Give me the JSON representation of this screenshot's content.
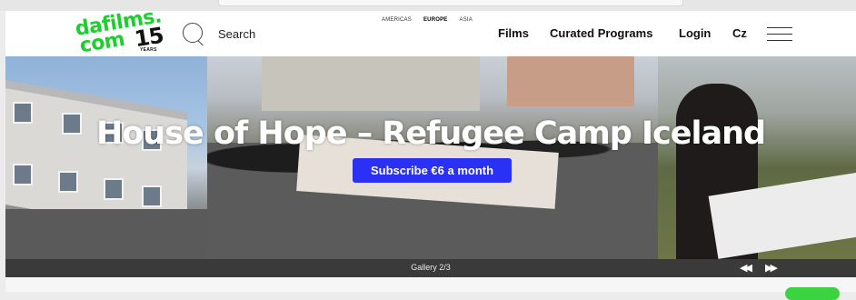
{
  "brand": {
    "logo_line1": "dafilms.",
    "logo_line2": "com",
    "anniversary_number": "15",
    "anniversary_word": "YEARS",
    "accent_color": "#1dcf2d"
  },
  "header": {
    "search_label": "Search",
    "regions": [
      "AMERICAS",
      "EUROPE",
      "ASIA"
    ],
    "active_region": "EUROPE",
    "nav": {
      "films": "Films",
      "curated_programs": "Curated Programs",
      "login": "Login",
      "language": "Cz"
    },
    "icons": {
      "search": "search-icon",
      "menu": "hamburger-menu-icon"
    }
  },
  "hero": {
    "title": "House of Hope – Refugee Camp Iceland",
    "subscribe_label": "Subscribe €6 a month",
    "subscribe_color": "#2b30f5"
  },
  "gallery": {
    "label": "Gallery 2/3",
    "prev_glyph": "◀◀",
    "next_glyph": "▶▶"
  }
}
